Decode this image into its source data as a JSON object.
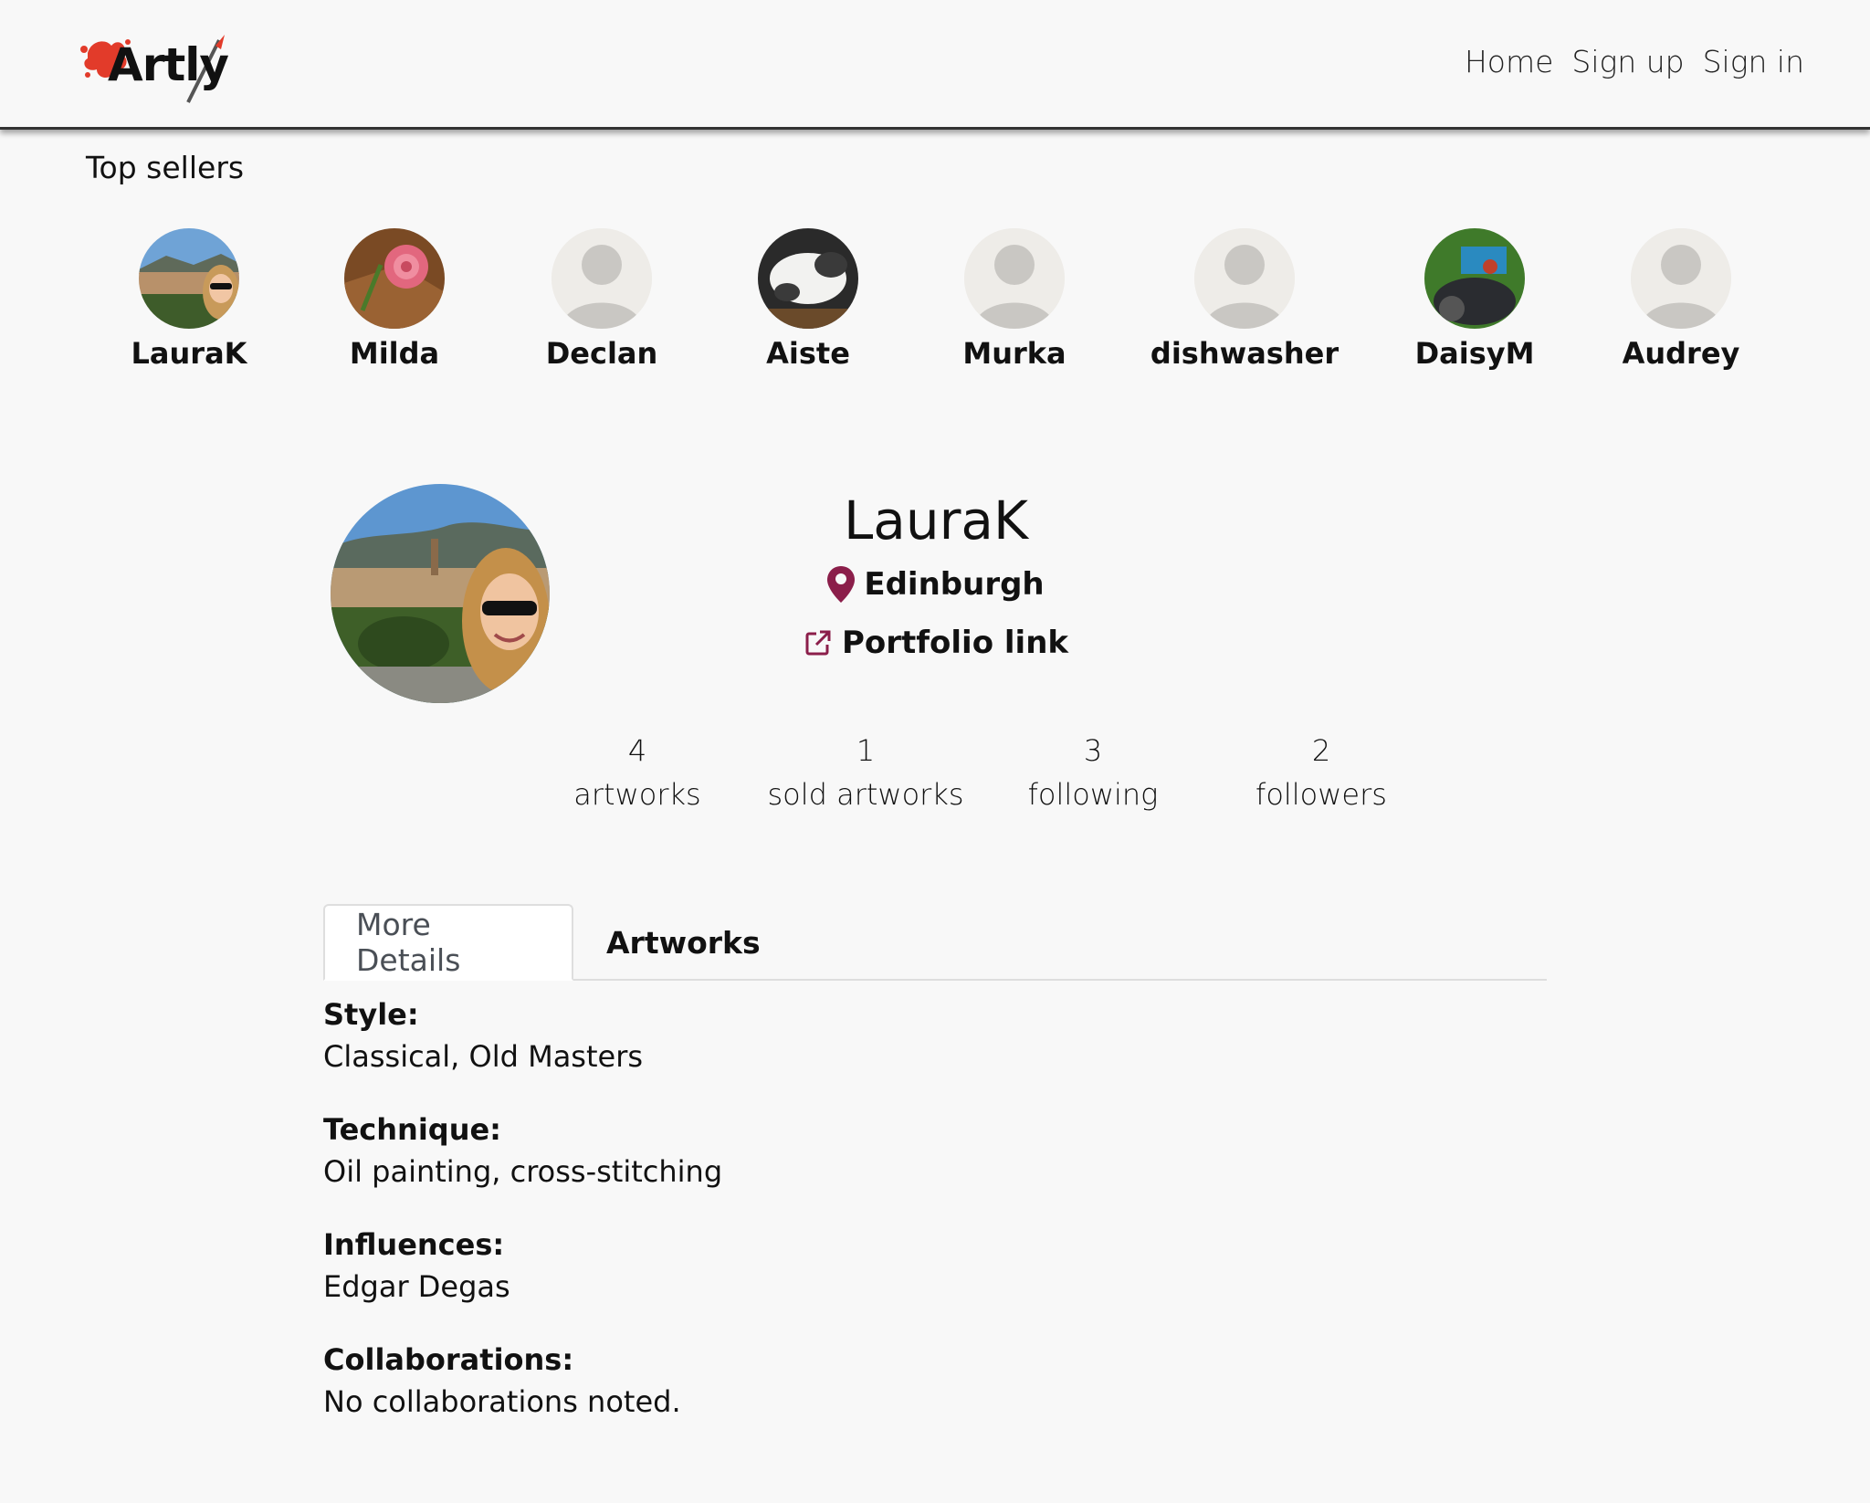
{
  "brand": {
    "name": "Artly",
    "accent_color": "#e23b2a"
  },
  "nav": {
    "home": "Home",
    "sign_up": "Sign up",
    "sign_in": "Sign in"
  },
  "top_sellers": {
    "title": "Top sellers",
    "sellers": [
      {
        "name": "LauraK",
        "avatar": "photo"
      },
      {
        "name": "Milda",
        "avatar": "photo"
      },
      {
        "name": "Declan",
        "avatar": "default-avatar-icon"
      },
      {
        "name": "Aiste",
        "avatar": "photo"
      },
      {
        "name": "Murka",
        "avatar": "default-avatar-icon"
      },
      {
        "name": "dishwasher",
        "avatar": "default-avatar-icon"
      },
      {
        "name": "DaisyM",
        "avatar": "photo"
      },
      {
        "name": "Audrey",
        "avatar": "default-avatar-icon"
      }
    ]
  },
  "profile": {
    "name": "LauraK",
    "location": "Edinburgh",
    "portfolio_label": "Portfolio link",
    "icon_color": "#8b1e4a",
    "stats": [
      {
        "value": "4",
        "label": "artworks"
      },
      {
        "value": "1",
        "label": "sold artworks"
      },
      {
        "value": "3",
        "label": "following"
      },
      {
        "value": "2",
        "label": "followers"
      }
    ]
  },
  "tabs": {
    "more_details": "More Details",
    "artworks": "Artworks"
  },
  "details": [
    {
      "label": "Style:",
      "value": "Classical, Old Masters"
    },
    {
      "label": "Technique:",
      "value": "Oil painting, cross-stitching"
    },
    {
      "label": "Influences:",
      "value": "Edgar Degas"
    },
    {
      "label": "Collaborations:",
      "value": "No collaborations noted."
    }
  ]
}
